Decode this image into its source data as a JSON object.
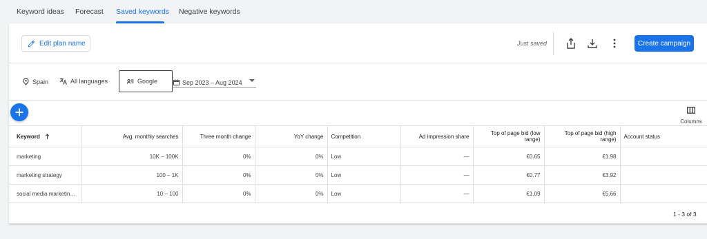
{
  "tabs": [
    {
      "label": "Keyword ideas"
    },
    {
      "label": "Forecast"
    },
    {
      "label": "Saved keywords"
    },
    {
      "label": "Negative keywords"
    }
  ],
  "active_tab": "Saved keywords",
  "toolbar": {
    "edit_plan_label": "Edit plan name",
    "status_text": "Just saved",
    "create_campaign_label": "Create campaign",
    "icons": [
      "share-icon",
      "download-icon",
      "more-vert-icon"
    ]
  },
  "filters": {
    "location": "Spain",
    "language": "All languages",
    "network": "Google",
    "date_range": "Sep 2023 – Aug 2024"
  },
  "columns_label": "Columns",
  "table": {
    "headers": {
      "keyword": "Keyword",
      "avg_monthly": "Avg. monthly searches",
      "three_month": "Three month change",
      "yoy": "YoY change",
      "competition": "Competition",
      "ad_share": "Ad impression share",
      "bid_low": "Top of page bid (low range)",
      "bid_high": "Top of page bid (high range)",
      "account_status": "Account status"
    },
    "rows": [
      {
        "keyword": "marketing",
        "avg_monthly": "10K – 100K",
        "three_month": "0%",
        "yoy": "0%",
        "competition": "Low",
        "ad_share": "—",
        "bid_low": "€0.65",
        "bid_high": "€1.98",
        "account_status": ""
      },
      {
        "keyword": "marketing strategy",
        "avg_monthly": "100 – 1K",
        "three_month": "0%",
        "yoy": "0%",
        "competition": "Low",
        "ad_share": "—",
        "bid_low": "€0.77",
        "bid_high": "€3.92",
        "account_status": ""
      },
      {
        "keyword": "social media marketing ...",
        "avg_monthly": "10 – 100",
        "three_month": "0%",
        "yoy": "0%",
        "competition": "Low",
        "ad_share": "—",
        "bid_low": "€1.09",
        "bid_high": "€5.66",
        "account_status": ""
      }
    ]
  },
  "pagination": "1 - 3 of 3",
  "colors": {
    "accent": "#1a73e8",
    "page_bg": "#f1f3f4"
  }
}
